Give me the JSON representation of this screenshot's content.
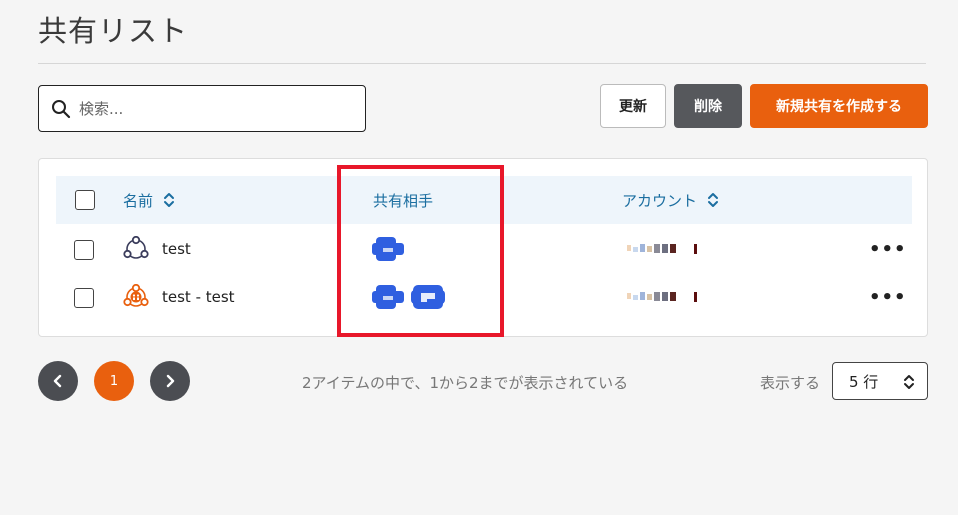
{
  "page": {
    "title": "共有リスト"
  },
  "search": {
    "placeholder": "検索..."
  },
  "toolbar": {
    "refresh_label": "更新",
    "delete_label": "削除",
    "create_label": "新規共有を作成する"
  },
  "table": {
    "headers": {
      "name": "名前",
      "shared_with": "共有相手",
      "account": "アカウント"
    },
    "rows": [
      {
        "name": "test",
        "icon": "group-outline-icon",
        "icon_color": "#3b3d5c",
        "shared_avatars": 1,
        "actions": "•••"
      },
      {
        "name": "test - test",
        "icon": "group-filled-icon",
        "icon_color": "#e9600e",
        "shared_avatars": 2,
        "actions": "•••"
      }
    ]
  },
  "pagination": {
    "current_page": "1",
    "info": "2アイテムの中で、1から2までが表示されている",
    "show_label": "表示する",
    "rows_per_page": "5 行"
  },
  "colors": {
    "accent": "#e9600e",
    "header_text": "#1b6ea0",
    "avatar_blue": "#2f5fe0",
    "highlight": "#e8172a"
  }
}
